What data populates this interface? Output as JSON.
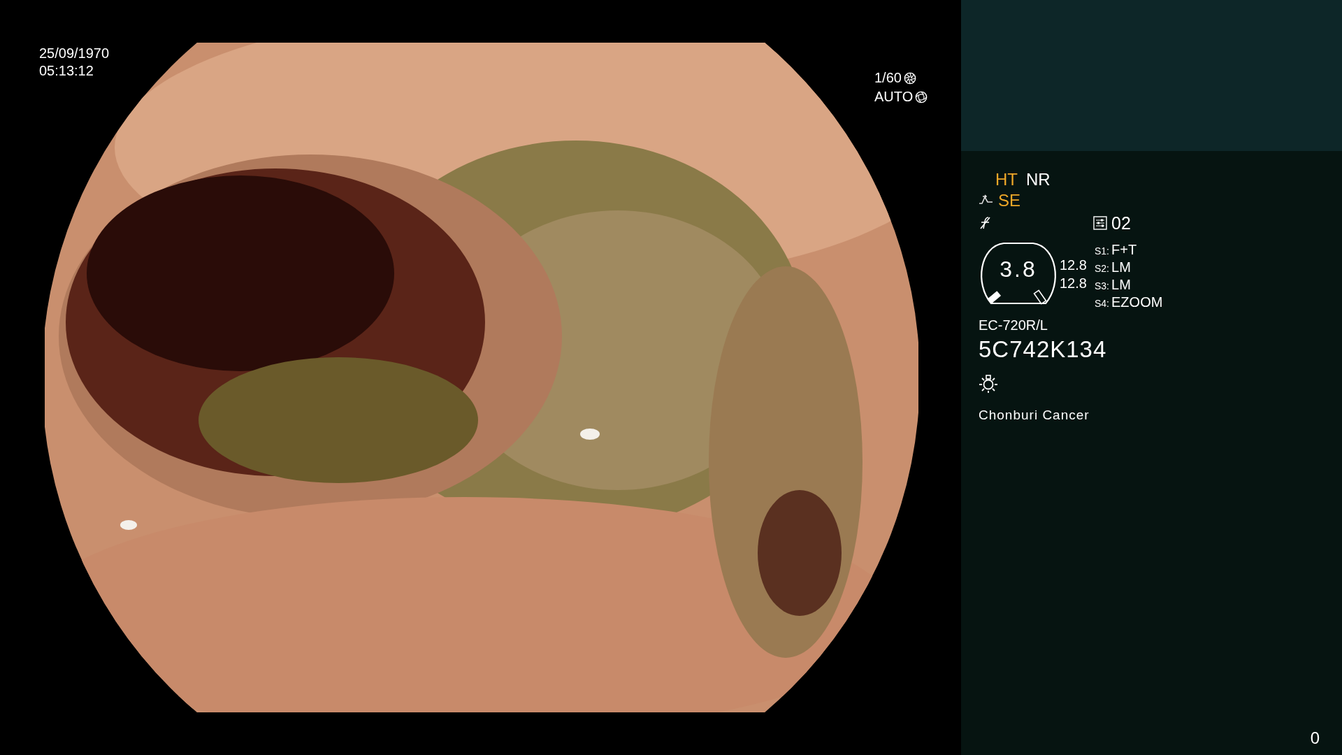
{
  "timestamp": {
    "date": "25/09/1970",
    "time": "05:13:12"
  },
  "exposure": {
    "shutter": "1/60",
    "iris": "AUTO"
  },
  "modes": [
    {
      "label": "HT",
      "on": true
    },
    {
      "label": "NR",
      "on": false
    }
  ],
  "enhancement": {
    "label": "SE",
    "on": true
  },
  "preset": "02",
  "zoom_dial": {
    "value": "3.8"
  },
  "readings": [
    "12.8",
    "12.8"
  ],
  "switches": [
    {
      "key": "S1:",
      "value": "F+T"
    },
    {
      "key": "S2:",
      "value": "LM"
    },
    {
      "key": "S3:",
      "value": "LM"
    },
    {
      "key": "S4:",
      "value": "EZOOM"
    }
  ],
  "scope_model": "EC-720R/L",
  "serial": "5C742K134",
  "institution": "Chonburi Cancer",
  "counter": "0"
}
